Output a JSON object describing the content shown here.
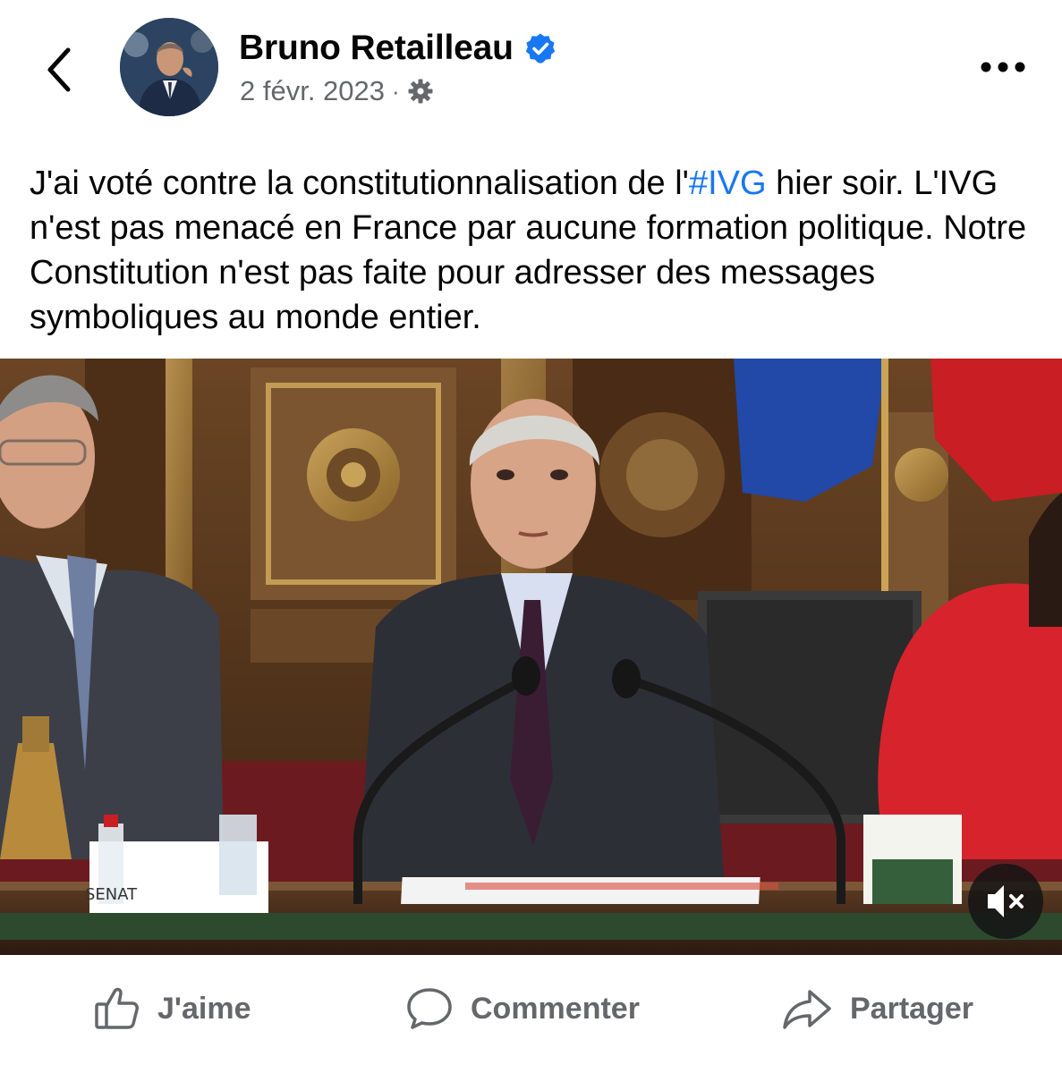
{
  "header": {
    "back_icon": "chevron-left-icon",
    "author_name": "Bruno Retailleau",
    "verified_icon": "verified-badge-icon",
    "date": "2 févr. 2023",
    "separator": "·",
    "audience_icon": "gear-icon",
    "more_icon": "more-horizontal-icon"
  },
  "post": {
    "text_before": "J'ai voté contre la constitutionnalisation de l'",
    "hashtag": "#IVG",
    "text_after": " hier soir. L'IVG n'est pas menacé en France par aucune formation politique. Notre Constitution n'est pas faite pour adresser des messages symboliques au monde entier."
  },
  "video": {
    "mute_icon": "speaker-muted-icon",
    "desk_sign": "SENAT"
  },
  "actions": {
    "like": {
      "label": "J'aime",
      "icon": "thumbs-up-icon"
    },
    "comment": {
      "label": "Commenter",
      "icon": "comment-bubble-icon"
    },
    "share": {
      "label": "Partager",
      "icon": "share-arrow-icon"
    }
  },
  "colors": {
    "link": "#1877f2",
    "secondary_text": "#65676b",
    "primary_text": "#050505"
  }
}
